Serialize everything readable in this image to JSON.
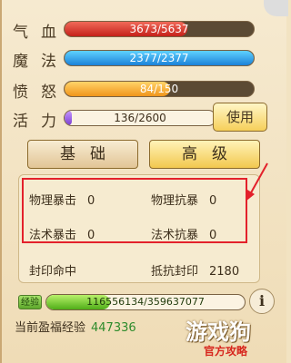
{
  "stats": [
    {
      "label": "气血",
      "value": "3673/5637",
      "fraction": 0.65
    },
    {
      "label": "魔法",
      "value": "2377/2377",
      "fraction": 1.0
    },
    {
      "label": "愤怒",
      "value": "84/150",
      "fraction": 0.56
    },
    {
      "label": "活力",
      "value": "136/2600",
      "fraction": 0.05
    }
  ],
  "use_button": "使用",
  "tabs": {
    "basic": "基础",
    "advanced": "高级"
  },
  "attributes": [
    {
      "name": "物理暴击",
      "value": "0"
    },
    {
      "name": "物理抗暴",
      "value": "0"
    },
    {
      "name": "法术暴击",
      "value": "0"
    },
    {
      "name": "法术抗暴",
      "value": "0"
    },
    {
      "name": "封印命中",
      "value": ""
    },
    {
      "name": "抵抗封印",
      "value": "2180"
    }
  ],
  "exp": {
    "icon_label": "经验",
    "value": "116556134/359637077",
    "fraction": 0.32
  },
  "info_label": "i",
  "bottom": {
    "label": "当前盈福经验",
    "value": "447336"
  },
  "watermark": {
    "main": "游戏狗",
    "sub": "官方攻略"
  },
  "colors": {
    "highlight_box": "#e3212b",
    "exp_value": "#2d8b2b"
  }
}
